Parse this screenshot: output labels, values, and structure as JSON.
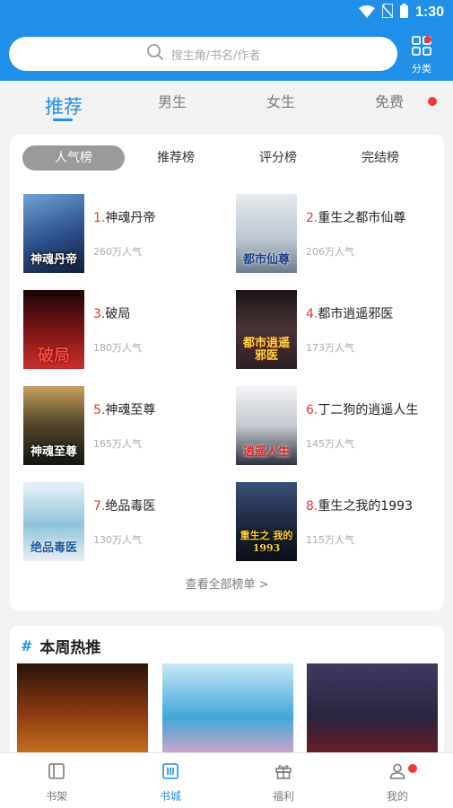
{
  "status_bar": {
    "time": "1:30"
  },
  "search": {
    "placeholder": "搜主角/书名/作者"
  },
  "category_button": {
    "label": "分类"
  },
  "tabs": [
    {
      "label": "推荐"
    },
    {
      "label": "男生"
    },
    {
      "label": "女生"
    },
    {
      "label": "免费"
    }
  ],
  "ranking": {
    "subtabs": [
      {
        "label": "人气榜"
      },
      {
        "label": "推荐榜"
      },
      {
        "label": "评分榜"
      },
      {
        "label": "完结榜"
      }
    ],
    "books": [
      {
        "rank": "1.",
        "title": "神魂丹帝",
        "popularity": "260万人气",
        "cover_text": "神魂丹帝",
        "color": "#2b4f8a"
      },
      {
        "rank": "2.",
        "title": "重生之都市仙尊",
        "popularity": "206万人气",
        "cover_text": "都市仙尊",
        "color": "#b8c4cf"
      },
      {
        "rank": "3.",
        "title": "破局",
        "popularity": "180万人气",
        "cover_text": "破局",
        "color": "#5a1010"
      },
      {
        "rank": "4.",
        "title": "都市逍遥邪医",
        "popularity": "173万人气",
        "cover_text": "都市逍遥邪医",
        "color": "#2a2024"
      },
      {
        "rank": "5.",
        "title": "神魂至尊",
        "popularity": "165万人气",
        "cover_text": "神魂至尊",
        "color": "#3c3420"
      },
      {
        "rank": "6.",
        "title": "丁二狗的逍遥人生",
        "popularity": "145万人气",
        "cover_text": "逍遥人生",
        "color": "#c6c9cf"
      },
      {
        "rank": "7.",
        "title": "绝品毒医",
        "popularity": "130万人气",
        "cover_text": "绝品毒医",
        "color": "#8fc4de"
      },
      {
        "rank": "8.",
        "title": "重生之我的1993",
        "popularity": "115万人气",
        "cover_text": "重生之 我的1993",
        "color": "#1e2a44"
      }
    ],
    "view_all": "查看全部榜单 >"
  },
  "weekly_hot": {
    "title": "本周热推",
    "covers": [
      {
        "color": "#5a2a12"
      },
      {
        "color": "#3fa7d8"
      },
      {
        "color": "#2b2440"
      }
    ]
  },
  "bottom_nav": [
    {
      "label": "书架"
    },
    {
      "label": "书城"
    },
    {
      "label": "福利"
    },
    {
      "label": "我的"
    }
  ],
  "colors": {
    "primary": "#1f8fe8",
    "badge": "#ec3a3a",
    "rank_number": "#e53935"
  }
}
